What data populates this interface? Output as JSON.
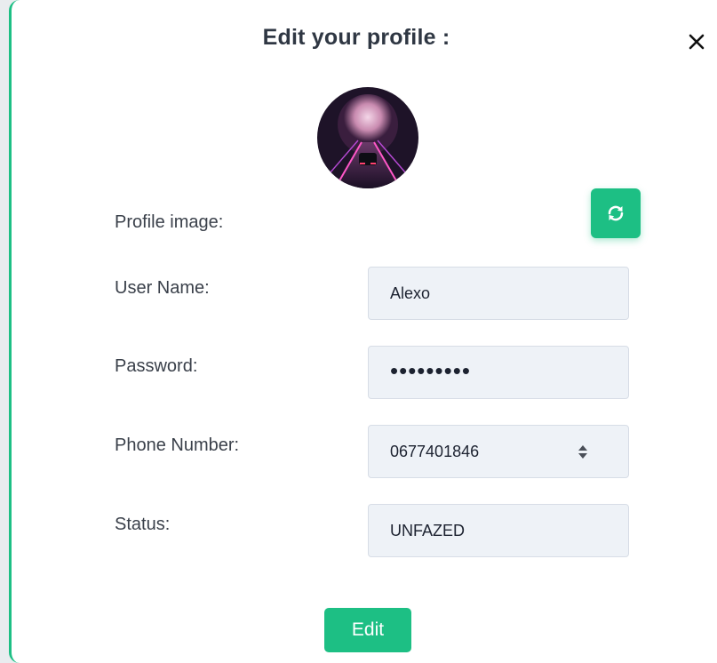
{
  "modal": {
    "title": "Edit your profile :",
    "close_icon": "close-icon",
    "accent_color": "#1dbf84"
  },
  "avatar": {
    "icon": "avatar-image"
  },
  "form": {
    "profile_image_label": "Profile image:",
    "refresh_icon": "refresh-icon",
    "username": {
      "label": "User Name:",
      "value": "Alexo"
    },
    "password": {
      "label": "Password:",
      "value": "•••••••••"
    },
    "phone": {
      "label": "Phone Number:",
      "value": "0677401846",
      "stepper_icon": "stepper-icon"
    },
    "status": {
      "label": "Status:",
      "value": "UNFAZED"
    }
  },
  "actions": {
    "edit_label": "Edit"
  }
}
